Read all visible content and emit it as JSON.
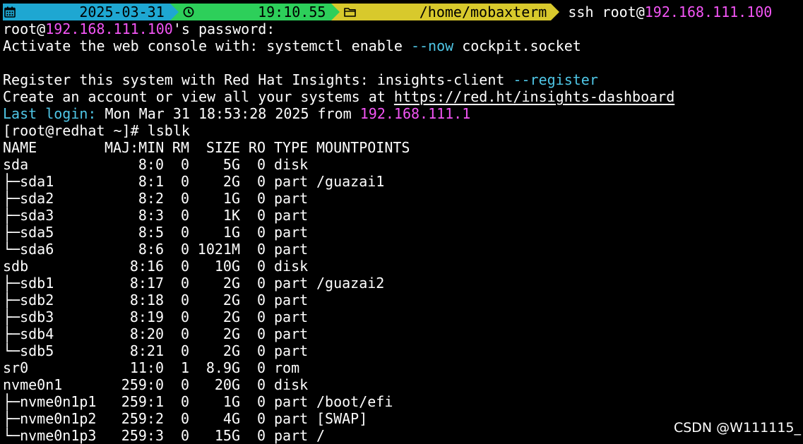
{
  "prompt_bar": {
    "date": "2025-03-31",
    "time": "19:10.55",
    "path": "/home/mobaxterm",
    "command_prefix": "ssh root@",
    "command_host": "192.168.111.100"
  },
  "output": {
    "password_prefix": "root@",
    "password_host": "192.168.111.100",
    "password_suffix": "'s password:",
    "console_a": "Activate the web console with: systemctl enable ",
    "console_flag": "--now",
    "console_b": " cockpit.socket",
    "register_a": "Register this system with Red Hat Insights: insights-client ",
    "register_flag": "--register",
    "account_a": "Create an account or view all your systems at ",
    "account_link": "https://red.ht/insights-dashboard",
    "last_login_label": "Last login:",
    "last_login_text": " Mon Mar 31 18:53:28 2025 from ",
    "last_login_host": "192.168.111.1",
    "shell_prompt": "[root@redhat ~]# lsblk"
  },
  "lsblk": {
    "headers": {
      "name": "NAME",
      "maj": "MAJ:MIN",
      "rm": "RM",
      "size": "SIZE",
      "ro": "RO",
      "type": "TYPE",
      "mnt": "MOUNTPOINTS"
    },
    "rows": [
      {
        "prefix": "",
        "name": "sda",
        "maj": "8:0",
        "rm": "0",
        "size": "5G",
        "ro": "0",
        "type": "disk",
        "mnt": ""
      },
      {
        "prefix": "├─",
        "name": "sda1",
        "maj": "8:1",
        "rm": "0",
        "size": "2G",
        "ro": "0",
        "type": "part",
        "mnt": "/guazai1"
      },
      {
        "prefix": "├─",
        "name": "sda2",
        "maj": "8:2",
        "rm": "0",
        "size": "1G",
        "ro": "0",
        "type": "part",
        "mnt": ""
      },
      {
        "prefix": "├─",
        "name": "sda3",
        "maj": "8:3",
        "rm": "0",
        "size": "1K",
        "ro": "0",
        "type": "part",
        "mnt": ""
      },
      {
        "prefix": "├─",
        "name": "sda5",
        "maj": "8:5",
        "rm": "0",
        "size": "1G",
        "ro": "0",
        "type": "part",
        "mnt": ""
      },
      {
        "prefix": "└─",
        "name": "sda6",
        "maj": "8:6",
        "rm": "0",
        "size": "1021M",
        "ro": "0",
        "type": "part",
        "mnt": ""
      },
      {
        "prefix": "",
        "name": "sdb",
        "maj": "8:16",
        "rm": "0",
        "size": "10G",
        "ro": "0",
        "type": "disk",
        "mnt": ""
      },
      {
        "prefix": "├─",
        "name": "sdb1",
        "maj": "8:17",
        "rm": "0",
        "size": "2G",
        "ro": "0",
        "type": "part",
        "mnt": "/guazai2"
      },
      {
        "prefix": "├─",
        "name": "sdb2",
        "maj": "8:18",
        "rm": "0",
        "size": "2G",
        "ro": "0",
        "type": "part",
        "mnt": ""
      },
      {
        "prefix": "├─",
        "name": "sdb3",
        "maj": "8:19",
        "rm": "0",
        "size": "2G",
        "ro": "0",
        "type": "part",
        "mnt": ""
      },
      {
        "prefix": "├─",
        "name": "sdb4",
        "maj": "8:20",
        "rm": "0",
        "size": "2G",
        "ro": "0",
        "type": "part",
        "mnt": ""
      },
      {
        "prefix": "└─",
        "name": "sdb5",
        "maj": "8:21",
        "rm": "0",
        "size": "2G",
        "ro": "0",
        "type": "part",
        "mnt": ""
      },
      {
        "prefix": "",
        "name": "sr0",
        "maj": "11:0",
        "rm": "1",
        "size": "8.9G",
        "ro": "0",
        "type": "rom",
        "mnt": ""
      },
      {
        "prefix": "",
        "name": "nvme0n1",
        "maj": "259:0",
        "rm": "0",
        "size": "20G",
        "ro": "0",
        "type": "disk",
        "mnt": ""
      },
      {
        "prefix": "├─",
        "name": "nvme0n1p1",
        "maj": "259:1",
        "rm": "0",
        "size": "1G",
        "ro": "0",
        "type": "part",
        "mnt": "/boot/efi"
      },
      {
        "prefix": "├─",
        "name": "nvme0n1p2",
        "maj": "259:2",
        "rm": "0",
        "size": "4G",
        "ro": "0",
        "type": "part",
        "mnt": "[SWAP]"
      },
      {
        "prefix": "└─",
        "name": "nvme0n1p3",
        "maj": "259:3",
        "rm": "0",
        "size": "15G",
        "ro": "0",
        "type": "part",
        "mnt": "/"
      }
    ]
  },
  "watermark": "CSDN @W111115_",
  "colors": {
    "background": "#000000",
    "text": "#ffffff",
    "ip_highlight": "#f355f5",
    "flag_highlight": "#4fc6e6",
    "segment_date": "#1ea7d2",
    "segment_time": "#2dcf5a",
    "segment_path": "#d8c92c"
  },
  "icons": {
    "date": "calendar-icon",
    "time": "clock-icon",
    "path": "folder-icon"
  }
}
